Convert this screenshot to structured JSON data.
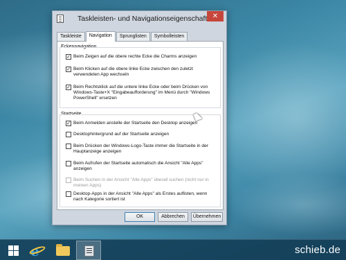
{
  "dialog": {
    "title": "Taskleisten- und Navigationseigenschaften",
    "close_symbol": "✕",
    "tabs": [
      {
        "label": "Taskleiste",
        "active": false
      },
      {
        "label": "Navigation",
        "active": true
      },
      {
        "label": "Sprunglisten",
        "active": false
      },
      {
        "label": "Symbolleisten",
        "active": false
      }
    ],
    "group_ecken": {
      "label": "Eckennavigation",
      "options": [
        {
          "label": "Beim Zeigen auf die obere rechte Ecke die Charms anzeigen",
          "checked": true,
          "enabled": true
        },
        {
          "label": "Beim Klicken auf die obere linke Ecke zwischen den zuletzt verwendeten App wechseln",
          "checked": true,
          "enabled": true
        },
        {
          "label": "Beim Rechtsklick auf die untere linke Ecke oder beim Drücken von Windows-Taste+X \"Eingabeaufforderung\" im Menü durch \"Windows PowerShell\" ersetzen",
          "checked": true,
          "enabled": true
        }
      ]
    },
    "group_start": {
      "label": "Startseite",
      "options": [
        {
          "label": "Beim Anmelden anstelle der Startseite den Desktop anzeigen",
          "checked": true,
          "enabled": true
        },
        {
          "label": "Desktophintergrund auf der Startseite anzeigen",
          "checked": false,
          "enabled": true
        },
        {
          "label": "Beim Drücken der Windows-Logo-Taste immer die Startseite in der Hauptanzeige anzeigen",
          "checked": false,
          "enabled": true
        },
        {
          "label": "Beim Aufrufen der Startseite automatisch die Ansicht \"Alle Apps\" anzeigen",
          "checked": false,
          "enabled": true
        },
        {
          "label": "Beim Suchen in der Ansicht \"Alle Apps\" überall suchen (nicht nur in meinen Apps)",
          "checked": false,
          "enabled": false
        },
        {
          "label": "Desktop-Apps in der Ansicht \"Alle Apps\" als Erstes auflisten, wenn nach Kategorie sortiert ist",
          "checked": false,
          "enabled": true
        }
      ]
    },
    "buttons": {
      "ok": "OK",
      "cancel": "Abbrechen",
      "apply": "Übernehmen"
    }
  },
  "taskbar": {
    "items": [
      {
        "icon": "windows-logo-icon"
      },
      {
        "icon": "internet-explorer-icon"
      },
      {
        "icon": "file-explorer-icon"
      },
      {
        "icon": "taskbar-properties-icon",
        "active": true
      }
    ]
  },
  "watermark": "schieb.de",
  "colors": {
    "close_button": "#c7463c",
    "dialog_bg": "#cfd6df",
    "taskbar": "#123c55"
  }
}
